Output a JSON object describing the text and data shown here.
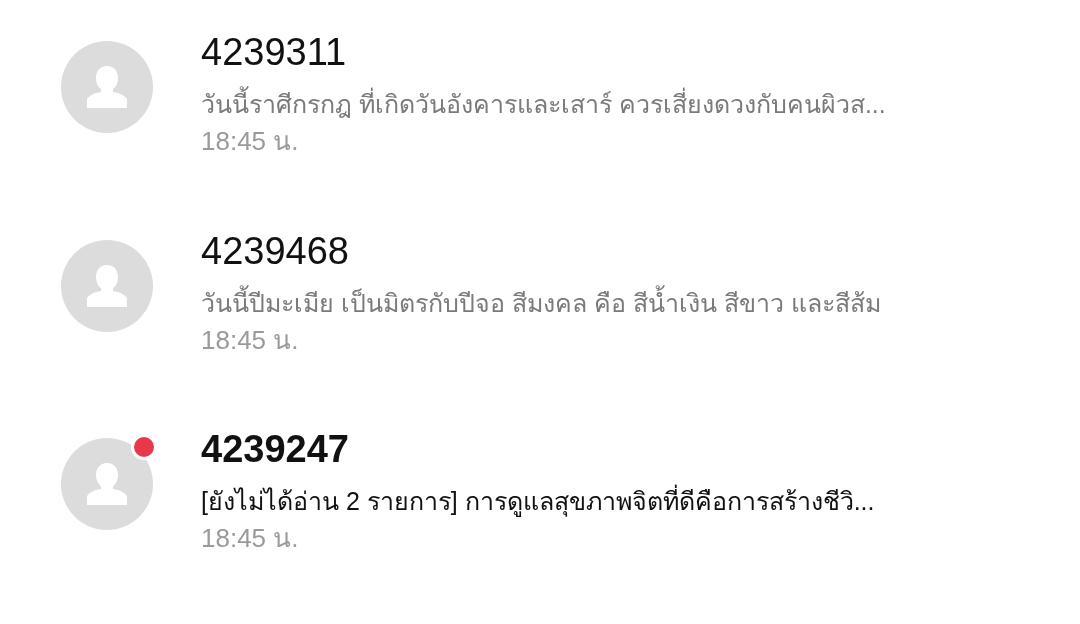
{
  "conversations": [
    {
      "name": "4239311",
      "preview": "วันนี้ราศีกรกฎ ที่เกิดวันอังคารและเสาร์ ควรเสี่ยงดวงกับคนผิวส...",
      "time": "18:45 น.",
      "unread": false
    },
    {
      "name": "4239468",
      "preview": "วันนี้ปีมะเมีย เป็นมิตรกับปีจอ สีมงคล คือ สีน้ำเงิน สีขาว และสีส้ม",
      "time": "18:45 น.",
      "unread": false
    },
    {
      "name": "4239247",
      "preview": "[ยังไม่ได้อ่าน 2 รายการ] การดูแลสุขภาพจิตที่ดีคือการสร้างชีวิ...",
      "time": "18:45 น.",
      "unread": true
    }
  ]
}
